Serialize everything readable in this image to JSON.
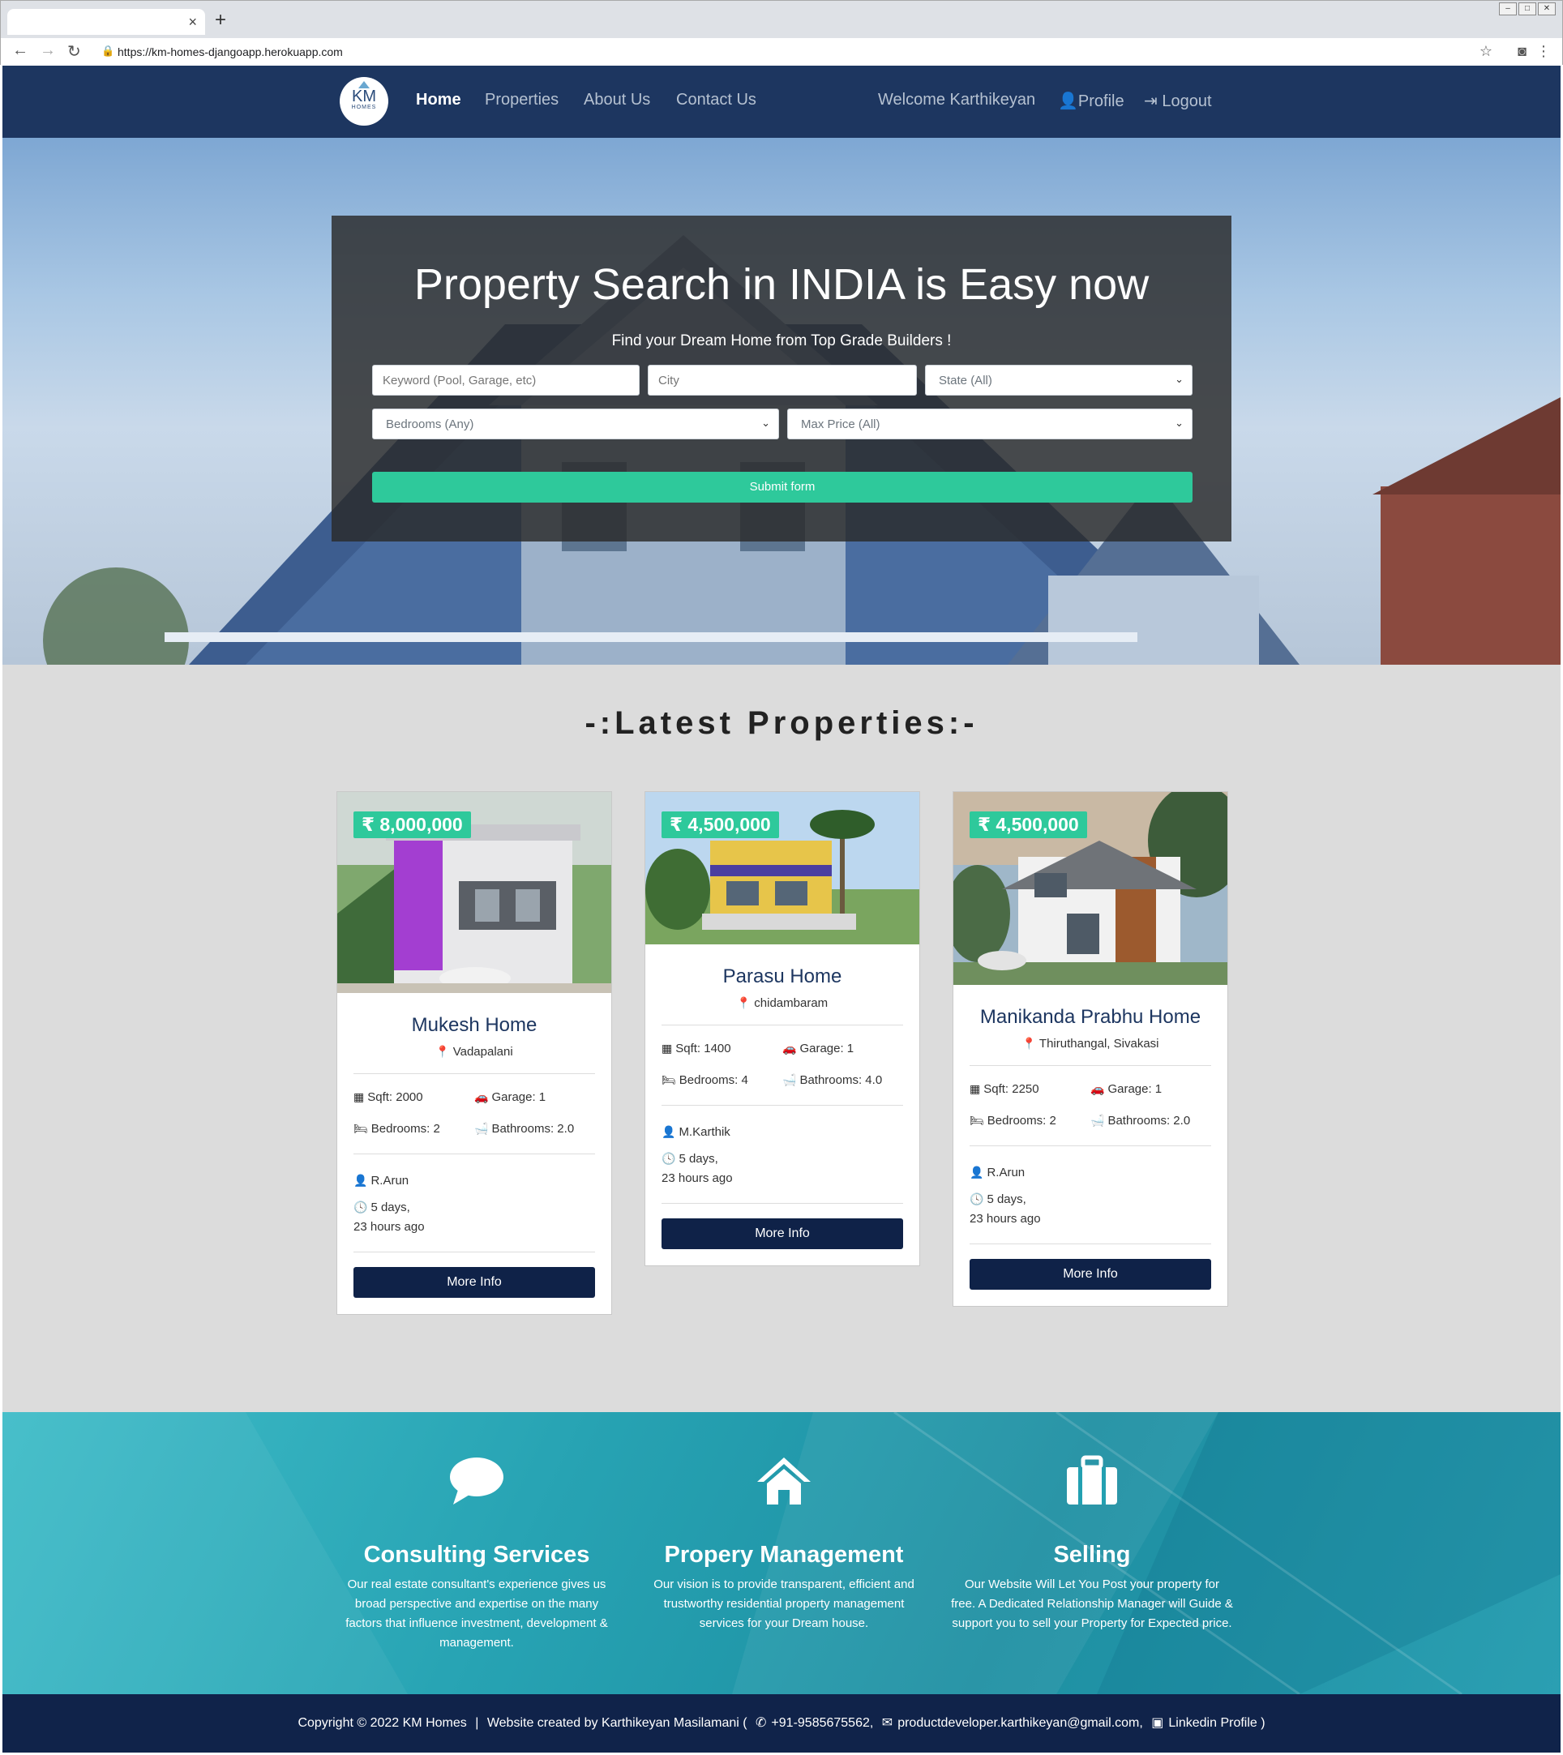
{
  "browser": {
    "url": "https://km-homes-djangoapp.herokuapp.com",
    "tab_close": "×",
    "new_tab": "+"
  },
  "nav": {
    "logo_text": "KM",
    "logo_sub": "HOMES",
    "links": [
      "Home",
      "Properties",
      "About Us",
      "Contact Us"
    ],
    "welcome": "Welcome Karthikeyan",
    "profile": "Profile",
    "logout": "Logout"
  },
  "hero": {
    "title": "Property Search in INDIA is Easy now",
    "subtitle": "Find your Dream Home from Top Grade Builders !",
    "keyword_placeholder": "Keyword (Pool, Garage, etc)",
    "city_placeholder": "City",
    "state_select": "State (All)",
    "bedrooms_select": "Bedrooms (Any)",
    "max_price_select": "Max Price (All)",
    "submit": "Submit form"
  },
  "latest": {
    "title": "-:Latest Properties:-",
    "listings": [
      {
        "price": "₹ 8,000,000",
        "title": "Mukesh Home",
        "location": "Vadapalani",
        "sqft": "Sqft: 2000",
        "garage": "Garage: 1",
        "bedrooms": "Bedrooms: 2",
        "bathrooms": "Bathrooms: 2.0",
        "realtor": "R.Arun",
        "time_line1": "5 days,",
        "time_line2": "23 hours ago",
        "button": "More Info"
      },
      {
        "price": "₹ 4,500,000",
        "title": "Parasu Home",
        "location": "chidambaram",
        "sqft": "Sqft: 1400",
        "garage": "Garage: 1",
        "bedrooms": "Bedrooms: 4",
        "bathrooms": "Bathrooms: 4.0",
        "realtor": "M.Karthik",
        "time_line1": "5 days,",
        "time_line2": "23 hours ago",
        "button": "More Info"
      },
      {
        "price": "₹ 4,500,000",
        "title": "Manikanda Prabhu Home",
        "location": "Thiruthangal, Sivakasi",
        "sqft": "Sqft: 2250",
        "garage": "Garage: 1",
        "bedrooms": "Bedrooms: 2",
        "bathrooms": "Bathrooms: 2.0",
        "realtor": "R.Arun",
        "time_line1": "5 days,",
        "time_line2": "23 hours ago",
        "button": "More Info"
      }
    ]
  },
  "services": [
    {
      "title": "Consulting Services",
      "text": "Our real estate consultant's experience gives us broad perspective and expertise on the many factors that influence investment, development & management."
    },
    {
      "title": "Propery Management",
      "text": "Our vision is to provide transparent, efficient and trustworthy residential property management services for your Dream house."
    },
    {
      "title": "Selling",
      "text": "Our Website Will Let You Post your property for free. A Dedicated Relationship Manager will Guide & support you to sell your Property for Expected price."
    }
  ],
  "footer": {
    "copyright": "Copyright © 2022 KM Homes",
    "separator": "|",
    "created_by": "Website created by Karthikeyan Masilamani (",
    "phone": "+91-9585675562,",
    "email": "productdeveloper.karthikeyan@gmail.com,",
    "linkedin": "Linkedin Profile )"
  },
  "colors": {
    "navbar": "#1d3660",
    "accent": "#2ec99b",
    "button": "#0f2248",
    "footer": "#10234a"
  }
}
